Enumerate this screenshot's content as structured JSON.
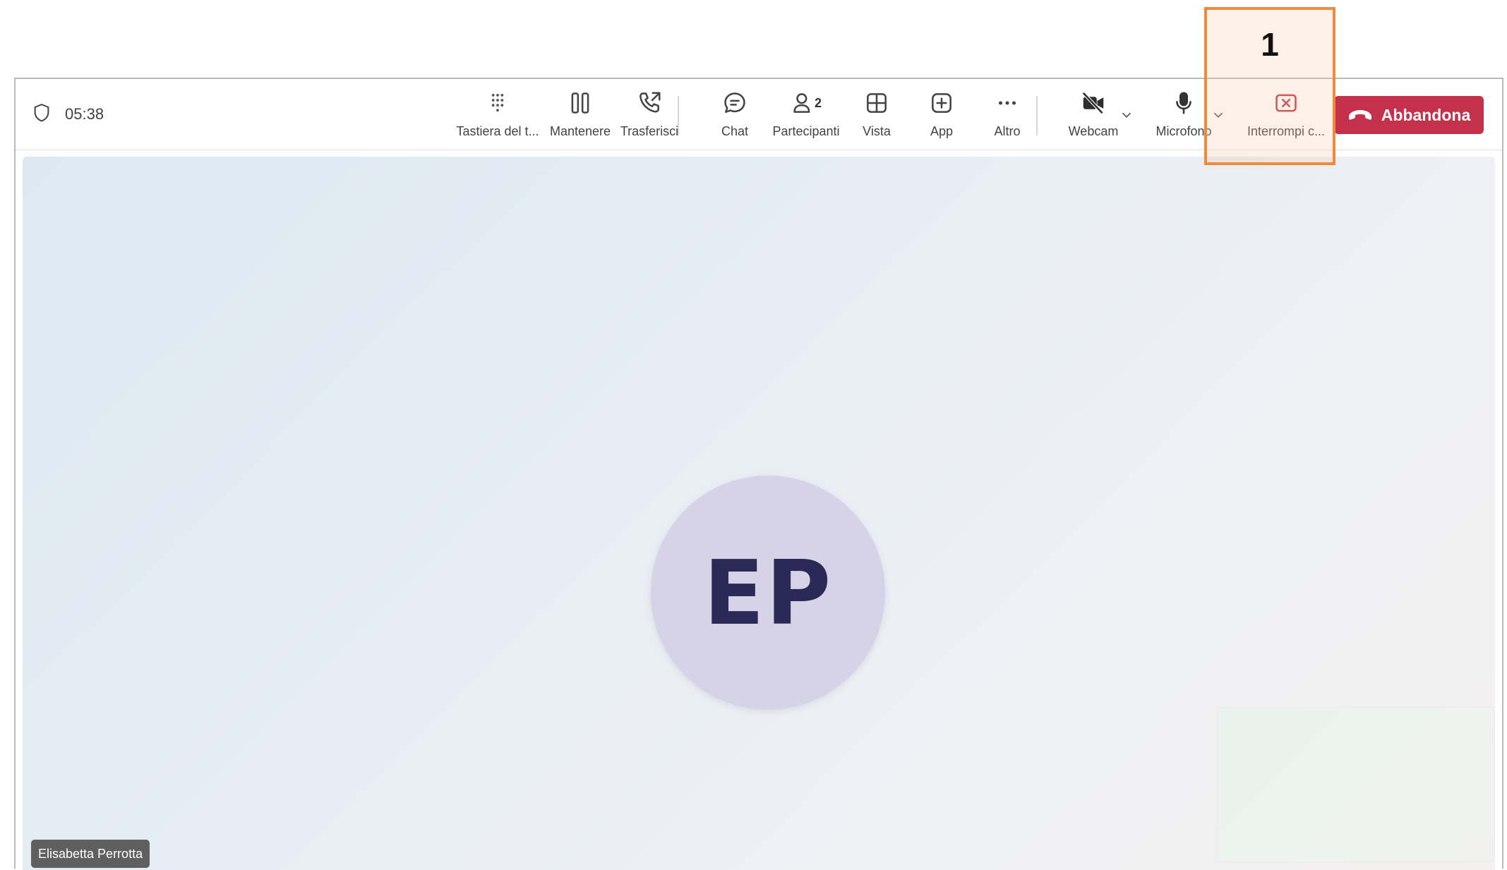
{
  "call": {
    "timer": "05:38"
  },
  "toolbar": {
    "items": [
      {
        "label": "Tastiera del t...",
        "icon": "dialpad-icon"
      },
      {
        "label": "Mantenere",
        "icon": "hold-icon"
      },
      {
        "label": "Trasferisci",
        "icon": "transfer-icon"
      },
      {
        "label": "Chat",
        "icon": "chat-icon"
      },
      {
        "label": "Partecipanti",
        "icon": "people-icon",
        "badge": "2"
      },
      {
        "label": "Vista",
        "icon": "grid-icon"
      },
      {
        "label": "App",
        "icon": "add-app-icon"
      },
      {
        "label": "Altro",
        "icon": "more-icon"
      },
      {
        "label": "Webcam",
        "icon": "camera-off-icon"
      },
      {
        "label": "Microfono",
        "icon": "mic-icon"
      },
      {
        "label": "Interrompi c...",
        "icon": "stop-share-icon"
      }
    ],
    "leave_label": "Abbandona"
  },
  "stage": {
    "avatar_initials": "EP",
    "participant_name": "Elisabetta Perrotta"
  },
  "callout": {
    "number": "1"
  },
  "colors": {
    "leave_button": "#c4314b",
    "callout_border": "#ef8a3c",
    "avatar_bg": "#d6d3e8",
    "stop_share": "#c4314b"
  }
}
